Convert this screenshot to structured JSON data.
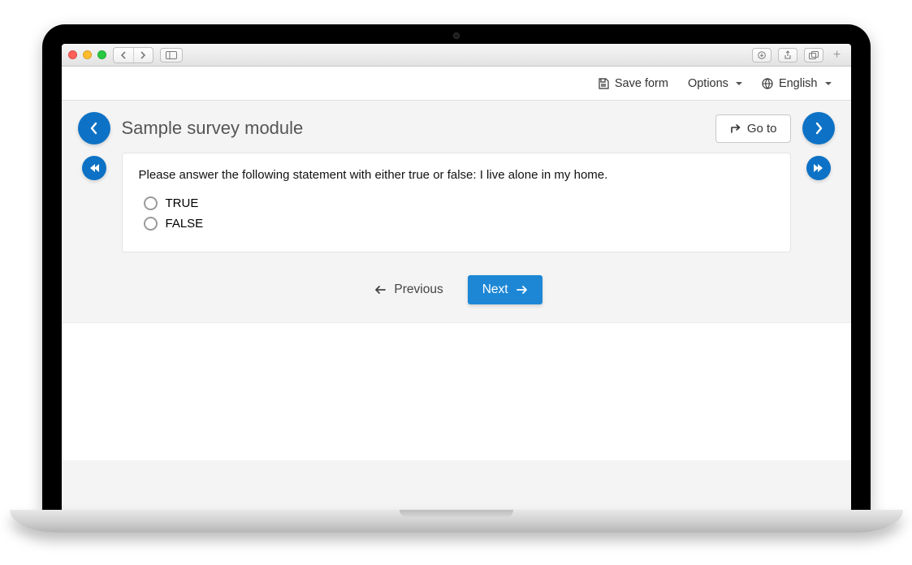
{
  "header": {
    "save_form": "Save form",
    "options": "Options",
    "language": "English"
  },
  "survey": {
    "title": "Sample survey module",
    "goto_label": "Go to",
    "question_text": "Please answer the following statement with either true or false: I live alone in my home.",
    "options": [
      "TRUE",
      "FALSE"
    ]
  },
  "nav": {
    "previous": "Previous",
    "next": "Next"
  },
  "colors": {
    "primary": "#0d72c5",
    "next_button": "#1d87d6"
  }
}
